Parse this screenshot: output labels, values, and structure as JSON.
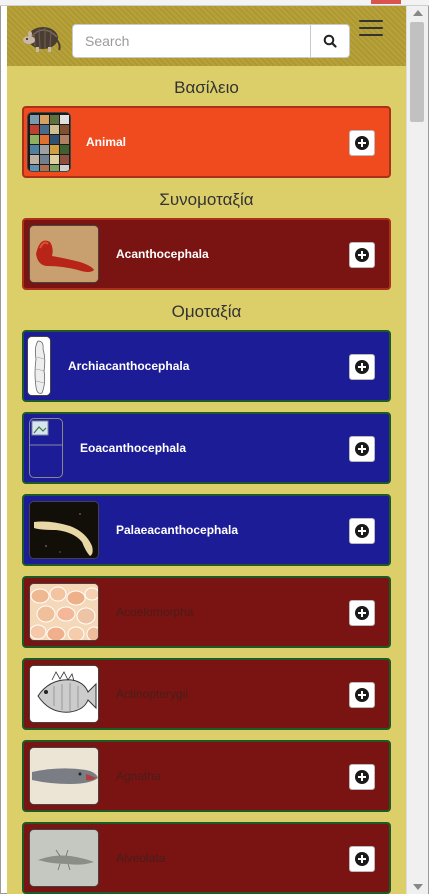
{
  "header": {
    "search_placeholder": "Search"
  },
  "sections": {
    "kingdom": "Βασίλειο",
    "phylum": "Συνομοταξία",
    "class": "Ομοταξία"
  },
  "cards": [
    {
      "label": "Animal",
      "color": "#f04a1f",
      "thumb": "animal-collage"
    },
    {
      "label": "Acanthocephala",
      "color": "#7a1412",
      "thumb": "red-worm"
    },
    {
      "label": "Archiacanthocephala",
      "color": "#1c1c96",
      "thumb": "worm-drawing"
    },
    {
      "label": "Eoacanthocephala",
      "color": "#1c1c96",
      "thumb": "broken-image"
    },
    {
      "label": "Palaeacanthocephala",
      "color": "#1c1c96",
      "thumb": "pale-worm"
    },
    {
      "label": "Acoelomorpha",
      "color": "#7a1412",
      "thumb": "peach-cells"
    },
    {
      "label": "Actinopterygii",
      "color": "#7a1412",
      "thumb": "fish-drawing"
    },
    {
      "label": "Agnatha",
      "color": "#7a1412",
      "thumb": "lamprey-photo"
    },
    {
      "label": "Alveolata",
      "color": "#7a1412",
      "thumb": "micro-organism"
    }
  ]
}
